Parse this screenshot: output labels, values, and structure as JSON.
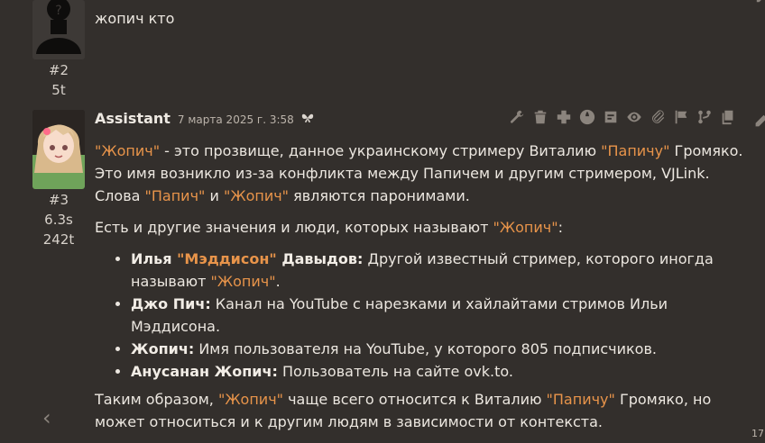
{
  "user_message": {
    "index": "#2",
    "time": "5t",
    "text": "жопич кто"
  },
  "assistant_message": {
    "sender": "Assistant",
    "date": "7 марта 2025 г. 3:58",
    "index": "#3",
    "time": "6.3s",
    "tokens": "242t",
    "toolbar": [
      "wrench-icon",
      "trash-icon",
      "plus-icon",
      "globe-icon",
      "note-icon",
      "eye-icon",
      "paperclip-icon",
      "flag-icon",
      "branch-icon",
      "copy-icon"
    ],
    "p1": {
      "q1": "\"Жопич\"",
      "t1": " - это прозвище, данное украинскому стримеру Виталию ",
      "q2": "\"Папичу\"",
      "t2": " Громяко. Это имя возникло из-за конфликта между Папичем и другим стримером, VJLink. Слова ",
      "q3": "\"Папич\"",
      "t3": " и ",
      "q4": "\"Жопич\"",
      "t4": " являются паронимами."
    },
    "p2": {
      "t1": "Есть и другие значения и люди, которых называют ",
      "q1": "\"Жопич\"",
      "t2": ":"
    },
    "list": [
      {
        "b1": "Илья ",
        "qb": "\"Мэддисон\"",
        "b2": " Давыдов:",
        "t1": " Другой известный стример, которого иногда называют ",
        "q": "\"Жопич\"",
        "t2": "."
      },
      {
        "b": "Джо Пич:",
        "t": " Канал на YouTube с нарезками и хайлайтами стримов Ильи Мэддисона."
      },
      {
        "b": "Жопич:",
        "t": " Имя пользователя на YouTube, у которого 805 подписчиков."
      },
      {
        "b": "Анусанан Жопич:",
        "t": " Пользователь на сайте ovk.to."
      }
    ],
    "p3": {
      "t1": "Таким образом, ",
      "q1": "\"Жопич\"",
      "t2": " чаще всего относится к Виталию ",
      "q2": "\"Папичу\"",
      "t3": " Громяко, но может относиться и к другим людям в зависимости от контекста."
    }
  },
  "nav": {
    "prev_arrow": "‹"
  },
  "edge": {
    "number": "17"
  }
}
